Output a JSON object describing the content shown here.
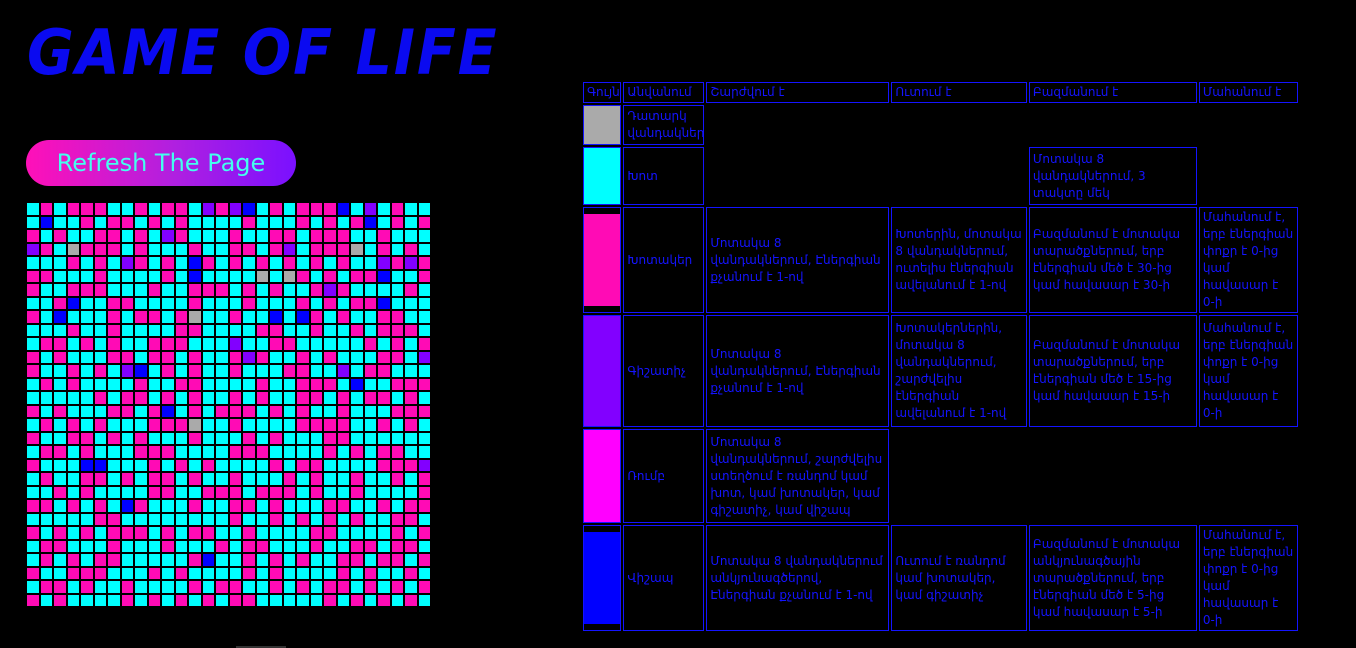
{
  "page": {
    "title": "GAME OF LIFE",
    "refresh_label": "Refresh The Page"
  },
  "colors": {
    "empty": "#aaaaaa",
    "grass": "#00ffff",
    "grass_eater": "#ff0bb5",
    "predator": "#8200ff",
    "bomb": "#ff00ff",
    "lightning": "#0000ff"
  },
  "legend": {
    "headers": [
      "Գույն",
      "Անվանում",
      "Շարժվում է",
      "Ուտում է",
      "Բազմանում է",
      "Մահանում է"
    ],
    "rows": [
      {
        "color": "#aaaaaa",
        "name": "Դատարկ վանդակներ",
        "moves": "",
        "eats": "",
        "multiplies": "",
        "dies": ""
      },
      {
        "color": "#00ffff",
        "name": "Խոտ",
        "moves": "",
        "eats": "",
        "multiplies": "Մոտակա 8 վանդակներում, 3 տակտը մեկ",
        "dies": ""
      },
      {
        "color": "#ff0bb5",
        "name": "Խոտակեր",
        "moves": "Մոտակա 8 վանդակներում, Էներգիան քչանում է 1-ով",
        "eats": "Խոտերին, մոտակա 8 վանդակներում, ուտելիս էներգիան ավելանում է 1-ով",
        "multiplies": "Բազմանում է մոտակա տարածքներում, երբ էներգիան մեծ է 30-ից կամ հավասար է 30-ի",
        "dies": "Մահանում է, երբ էներգիան փոքր է 0-ից կամ հավասար է 0-ի"
      },
      {
        "color": "#8200ff",
        "name": "Գիշատիչ",
        "moves": "Մոտակա 8 վանդակներում, Էներգիան քչանում է 1-ով",
        "eats": "Խոտակերներին, մոտակա 8 վանդակներում, շարժվելիս էներգիան ավելանում է 1-ով",
        "multiplies": "Բազմանում է մոտակա տարածքներում, երբ էներգիան մեծ է 15-ից կամ հավասար է 15-ի",
        "dies": "Մահանում է, երբ էներգիան փոքր է 0-ից կամ հավասար է 0-ի"
      },
      {
        "color": "#ff00ff",
        "name": "Ռումբ",
        "moves": "Մոտակա 8 վանդակներում, շարժվելիս ստեղծում է ռանդոմ կամ խոտ, կամ խոտակեր, կամ գիշատիչ, կամ վիշապ",
        "eats": "",
        "multiplies": "",
        "dies": ""
      },
      {
        "color": "#0000ff",
        "name": "Վիշապ",
        "moves": "Մոտակա 8 վանդակներում անկյունագծերով, Էներգիան քչանում է 1-ով",
        "eats": "Ուտում է ռանդոմ կամ խոտակեր, կամ գիշատիչ",
        "multiplies": "Բազմանում է մոտակա անկյունագծային տարածքներում, երբ էներգիան մեծ է 5-ից կամ հավասար է 5-ի",
        "dies": "Մահանում է, երբ էներգիան փոքր է 0-ից կամ հավասար է 0-ի"
      }
    ]
  },
  "board": {
    "rows": 30,
    "cols": 30,
    "palette": [
      "#aaaaaa",
      "#00ffff",
      "#ff0bb5",
      "#8200ff",
      "#ff00ff",
      "#0000ff"
    ],
    "cells": [
      "121222112122132351212225131211",
      "151121221212111121112121251212",
      "212112212132111211221222112111",
      "321022212111211221231222012121",
      "111212132121521212121212113232",
      "221112111121511110102121225112",
      "211222111211222121211232111121",
      "112511221111211121112121225111",
      "215111212212011211515212112211",
      "111211211112211112211211212221",
      "122121211222111311221111121212",
      "212111221221211232112121112213",
      "211212135121211211122113122111",
      "121211112112211112112221511222",
      "111112122121211212112212122121",
      "212111221251212221212112111222",
      "121212111222011211112222112121",
      "211221212111211121211122111111",
      "122121112221111222111121212211",
      "211155111212121111212211112223",
      "121122121221211211121211211212",
      "112121111221122212221211211112",
      "221212152111211221211122112122",
      "111112211111111211212121211221",
      "212121222121221121111221111212",
      "122111211121112122111211221221",
      "121212211111251121212112212212",
      "211222111212111121211112121121",
      "122121121111212211212122121212",
      "212111121212121221111121212121"
    ]
  }
}
